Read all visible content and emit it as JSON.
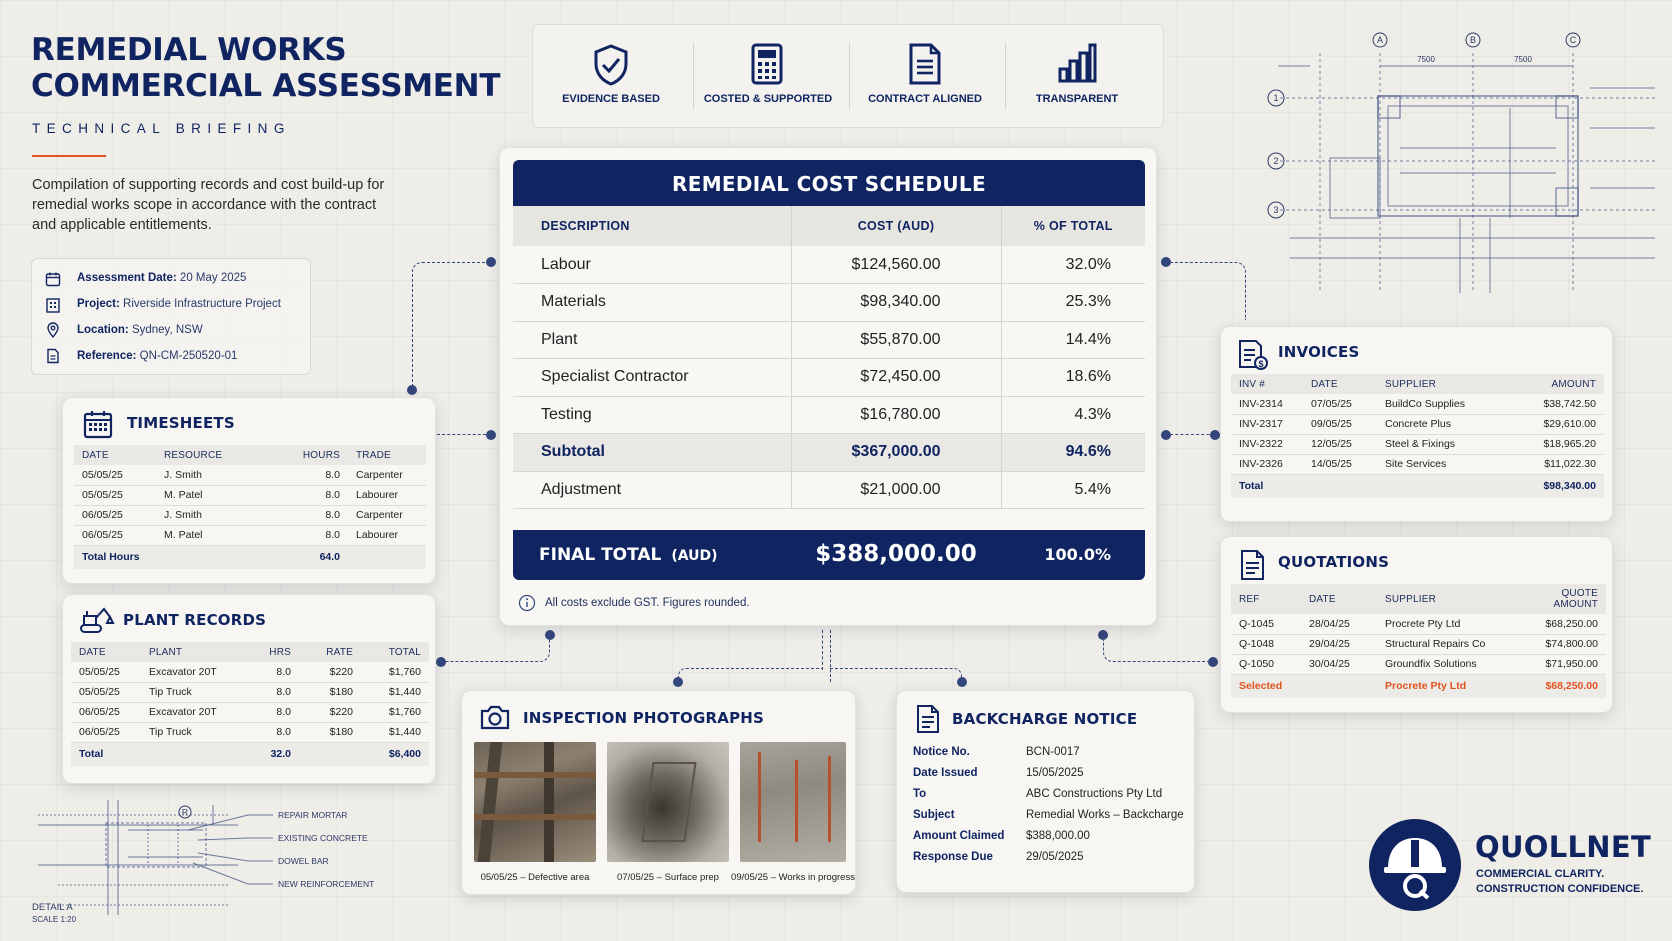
{
  "header": {
    "title_line1": "REMEDIAL WORKS",
    "title_line2": "COMMERCIAL ASSESSMENT",
    "subtitle": "TECHNICAL BRIEFING",
    "description": "Compilation of supporting records and cost build-up for remedial works scope in accordance with the contract and applicable entitlements."
  },
  "meta": {
    "assessment_date_label": "Assessment Date:",
    "assessment_date": "20 May 2025",
    "project_label": "Project:",
    "project": "Riverside Infrastructure Project",
    "location_label": "Location:",
    "location": "Sydney, NSW",
    "reference_label": "Reference:",
    "reference": "QN-CM-250520-01"
  },
  "principles": [
    {
      "label": "EVIDENCE BASED",
      "icon": "shield-check-icon"
    },
    {
      "label": "COSTED & SUPPORTED",
      "icon": "calculator-icon"
    },
    {
      "label": "CONTRACT ALIGNED",
      "icon": "document-icon"
    },
    {
      "label": "TRANSPARENT",
      "icon": "bar-chart-icon"
    }
  ],
  "schedule": {
    "title": "REMEDIAL COST SCHEDULE",
    "columns": [
      "DESCRIPTION",
      "COST (AUD)",
      "% OF TOTAL"
    ],
    "rows": [
      {
        "description": "Labour",
        "cost": "$124,560.00",
        "pct": "32.0%"
      },
      {
        "description": "Materials",
        "cost": "$98,340.00",
        "pct": "25.3%"
      },
      {
        "description": "Plant",
        "cost": "$55,870.00",
        "pct": "14.4%"
      },
      {
        "description": "Specialist Contractor",
        "cost": "$72,450.00",
        "pct": "18.6%"
      },
      {
        "description": "Testing",
        "cost": "$16,780.00",
        "pct": "4.3%"
      }
    ],
    "subtotal": {
      "description": "Subtotal",
      "cost": "$367,000.00",
      "pct": "94.6%"
    },
    "adjustment": {
      "description": "Adjustment",
      "cost": "$21,000.00",
      "pct": "5.4%"
    },
    "final": {
      "label": "FINAL TOTAL",
      "unit": "(AUD)",
      "cost": "$388,000.00",
      "pct": "100.0%"
    },
    "note": "All costs exclude GST. Figures rounded."
  },
  "timesheets": {
    "title": "TIMESHEETS",
    "columns": [
      "DATE",
      "RESOURCE",
      "HOURS",
      "TRADE"
    ],
    "rows": [
      [
        "05/05/25",
        "J. Smith",
        "8.0",
        "Carpenter"
      ],
      [
        "05/05/25",
        "M. Patel",
        "8.0",
        "Labourer"
      ],
      [
        "06/05/25",
        "J. Smith",
        "8.0",
        "Carpenter"
      ],
      [
        "06/05/25",
        "M. Patel",
        "8.0",
        "Labourer"
      ]
    ],
    "total_label": "Total Hours",
    "total": "64.0"
  },
  "plant": {
    "title": "PLANT RECORDS",
    "columns": [
      "DATE",
      "PLANT",
      "HRS",
      "RATE",
      "TOTAL"
    ],
    "rows": [
      [
        "05/05/25",
        "Excavator  20T",
        "8.0",
        "$220",
        "$1,760"
      ],
      [
        "05/05/25",
        "Tip Truck",
        "8.0",
        "$180",
        "$1,440"
      ],
      [
        "06/05/25",
        "Excavator  20T",
        "8.0",
        "$220",
        "$1,760"
      ],
      [
        "06/05/25",
        "Tip Truck",
        "8.0",
        "$180",
        "$1,440"
      ]
    ],
    "total_label": "Total",
    "total_hrs": "32.0",
    "total_amount": "$6,400"
  },
  "invoices": {
    "title": "INVOICES",
    "columns": [
      "INV #",
      "DATE",
      "SUPPLIER",
      "AMOUNT"
    ],
    "rows": [
      [
        "INV-2314",
        "07/05/25",
        "BuildCo Supplies",
        "$38,742.50"
      ],
      [
        "INV-2317",
        "09/05/25",
        "Concrete Plus",
        "$29,610.00"
      ],
      [
        "INV-2322",
        "12/05/25",
        "Steel & Fixings",
        "$18,965.20"
      ],
      [
        "INV-2326",
        "14/05/25",
        "Site Services",
        "$11,022.30"
      ]
    ],
    "total_label": "Total",
    "total": "$98,340.00"
  },
  "quotations": {
    "title": "QUOTATIONS",
    "columns": [
      "REF",
      "DATE",
      "SUPPLIER",
      "QUOTE AMOUNT"
    ],
    "rows": [
      [
        "Q-1045",
        "28/04/25",
        "Procrete Pty Ltd",
        "$68,250.00"
      ],
      [
        "Q-1048",
        "29/04/25",
        "Structural Repairs Co",
        "$74,800.00"
      ],
      [
        "Q-1050",
        "30/04/25",
        "Groundfix Solutions",
        "$71,950.00"
      ]
    ],
    "selected_label": "Selected",
    "selected_supplier": "Procrete Pty Ltd",
    "selected_amount": "$68,250.00",
    "highlight_color": "#e0531f"
  },
  "photos": {
    "title": "INSPECTION PHOTOGRAPHS",
    "captions": [
      "05/05/25 – Defective area",
      "07/05/25 – Surface prep",
      "09/05/25 – Works in progress"
    ]
  },
  "backcharge": {
    "title": "BACKCHARGE NOTICE",
    "fields": [
      {
        "label": "Notice No.",
        "value": "BCN-0017"
      },
      {
        "label": "Date Issued",
        "value": "15/05/2025"
      },
      {
        "label": "To",
        "value": "ABC Constructions Pty Ltd"
      },
      {
        "label": "Subject",
        "value": "Remedial Works – Backcharge"
      },
      {
        "label": "Amount Claimed",
        "value": "$388,000.00"
      },
      {
        "label": "Response Due",
        "value": "29/05/2025"
      }
    ]
  },
  "detail": {
    "labels": [
      "REPAIR MORTAR",
      "EXISTING CONCRETE",
      "DOWEL BAR",
      "NEW REINFORCEMENT"
    ],
    "marker": "R",
    "title": "DETAIL  A",
    "scale": "SCALE 1:20"
  },
  "plan": {
    "grid_cols": [
      "A",
      "B",
      "C"
    ],
    "grid_rows": [
      "1",
      "2",
      "3"
    ],
    "dims": [
      "7500",
      "7500"
    ]
  },
  "brand": {
    "name": "QUOLLNET",
    "tagline1": "COMMERCIAL CLARITY.",
    "tagline2": "CONSTRUCTION CONFIDENCE."
  },
  "colors": {
    "navy": "#0f2461",
    "accent": "#e0531f",
    "background": "#eeede8"
  }
}
